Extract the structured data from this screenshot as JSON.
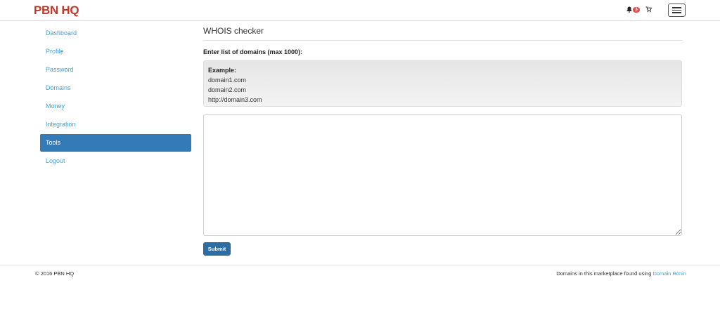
{
  "header": {
    "brand": "PBN HQ",
    "notification_count": "3",
    "accent_color": "#c0392b",
    "icons": [
      "bell-icon",
      "cart-icon",
      "hamburger-menu-icon"
    ]
  },
  "sidebar": {
    "items": [
      {
        "label": "Dashboard"
      },
      {
        "label": "Profile"
      },
      {
        "label": "Password"
      },
      {
        "label": "Domains"
      },
      {
        "label": "Money"
      },
      {
        "label": "Integration"
      },
      {
        "label": "Tools",
        "active": true
      },
      {
        "label": "Logout"
      }
    ],
    "active_color": "#337ab7",
    "link_color": "#3aa6d8"
  },
  "main": {
    "title": "WHOIS checker",
    "field_label": "Enter list of domains (max 1000):",
    "example": {
      "heading": "Example:",
      "lines": [
        "domain1.com",
        "domain2.com",
        "http://domain3.com"
      ]
    },
    "textarea_value": "",
    "submit_label": "Submit"
  },
  "footer": {
    "copyright": "© 2016 PBN HQ",
    "text": "Domains in this marketplace found using",
    "link": "Domain Ronin"
  }
}
